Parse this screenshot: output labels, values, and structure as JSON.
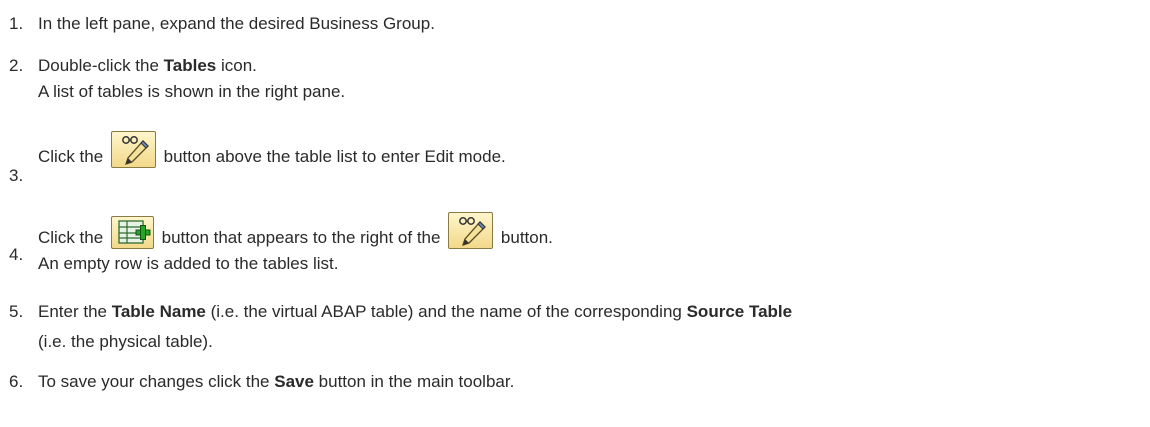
{
  "steps": [
    {
      "num": "1.",
      "text": "In the left pane, expand the desired Business Group."
    },
    {
      "num": "2.",
      "a": "Double-click the ",
      "b": "Tables",
      "c": " icon.",
      "sub": "A list of tables is shown in the right pane."
    },
    {
      "num": "3.",
      "a": "Click the ",
      "c": " button above the table list to enter Edit mode."
    },
    {
      "num": "4.",
      "a": "Click the ",
      "c": " button that appears to the right of the ",
      "e": " button.",
      "sub": "An empty row is added to the tables list."
    },
    {
      "num": "5.",
      "a": "Enter the ",
      "b": "Table Name",
      "c": " (i.e. the virtual ABAP table) and the name of the corresponding ",
      "d": "Source Table",
      "sub": "(i.e. the physical table)."
    },
    {
      "num": "6.",
      "a": "To save your changes click the ",
      "b": "Save",
      "c": " button in the main toolbar."
    }
  ],
  "icons": {
    "edit": "edit-pencil-glasses-icon",
    "add": "add-row-icon"
  }
}
